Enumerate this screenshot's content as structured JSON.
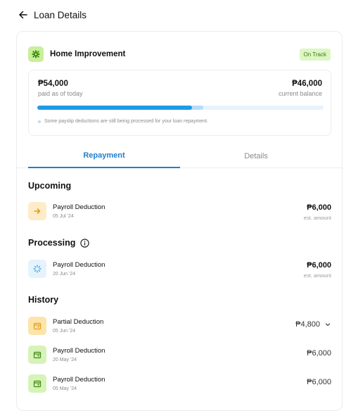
{
  "header": {
    "title": "Loan Details",
    "back_icon": "arrow-left-icon"
  },
  "loan": {
    "name": "Home Improvement",
    "icon": "gear-icon",
    "icon_bg": "#c9ef9a",
    "status": "On Track",
    "paid_amount": "₱54,000",
    "paid_label": "paid as of today",
    "balance_amount": "₱46,000",
    "balance_label": "current balance",
    "progress_paid_fraction": 0.54,
    "progress_pending_fraction": 0.58,
    "note": "Some payslip deductions are still being processed for your loan repayment."
  },
  "tabs": [
    {
      "label": "Repayment",
      "active": true
    },
    {
      "label": "Details",
      "active": false
    }
  ],
  "upcoming": {
    "title": "Upcoming",
    "items": [
      {
        "label": "Payroll Deduction",
        "date": "05 Jul '24",
        "amount": "₱6,000",
        "sub": "est. amount",
        "icon": "arrow-right-icon"
      }
    ]
  },
  "processing": {
    "title": "Processing",
    "items": [
      {
        "label": "Payroll Deduction",
        "date": "20 Jun '24",
        "amount": "₱6,000",
        "sub": "est. amount",
        "icon": "spinner-icon"
      }
    ]
  },
  "history": {
    "title": "History",
    "items": [
      {
        "label": "Partial Deduction",
        "date": "05 Jun '24",
        "amount": "₱4,800",
        "icon": "calendar-icon"
      },
      {
        "label": "Payroll Deduction",
        "date": "20 May '24",
        "amount": "₱6,000",
        "icon": "calendar-icon"
      },
      {
        "label": "Payroll Deduction",
        "date": "05 May '24",
        "amount": "₱6,000",
        "icon": "calendar-icon"
      }
    ]
  },
  "colors": {
    "accent": "#1e7fd0",
    "progress": "#1e9be6",
    "upcoming_icon_bg": "#fdecc8",
    "processing_icon_bg": "#e6f3fc",
    "history_partial_bg": "#fde4a8",
    "history_full_bg": "#d6f3b8"
  }
}
